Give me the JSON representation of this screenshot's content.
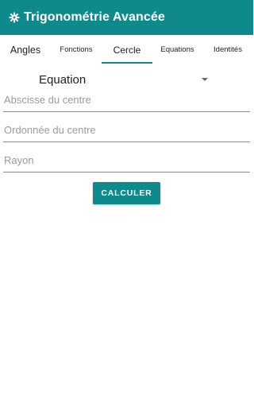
{
  "app": {
    "title": "Trigonométrie Avancée",
    "icon": "settings-gear-icon",
    "brand_color": "#0e8a8d"
  },
  "tabs": [
    {
      "label": "Angles",
      "selected": false
    },
    {
      "label": "Fonctions",
      "selected": false
    },
    {
      "label": "Cercle",
      "selected": true
    },
    {
      "label": "Equations",
      "selected": false
    },
    {
      "label": "Identités",
      "selected": false
    }
  ],
  "form": {
    "mode_select": {
      "selected": "Equation"
    },
    "abscisse": {
      "value": "",
      "placeholder": "Abscisse du centre"
    },
    "ordonnee": {
      "value": "",
      "placeholder": "Ordonnée du centre"
    },
    "rayon": {
      "value": "",
      "placeholder": "Rayon"
    },
    "submit_label": "CALCULER"
  }
}
